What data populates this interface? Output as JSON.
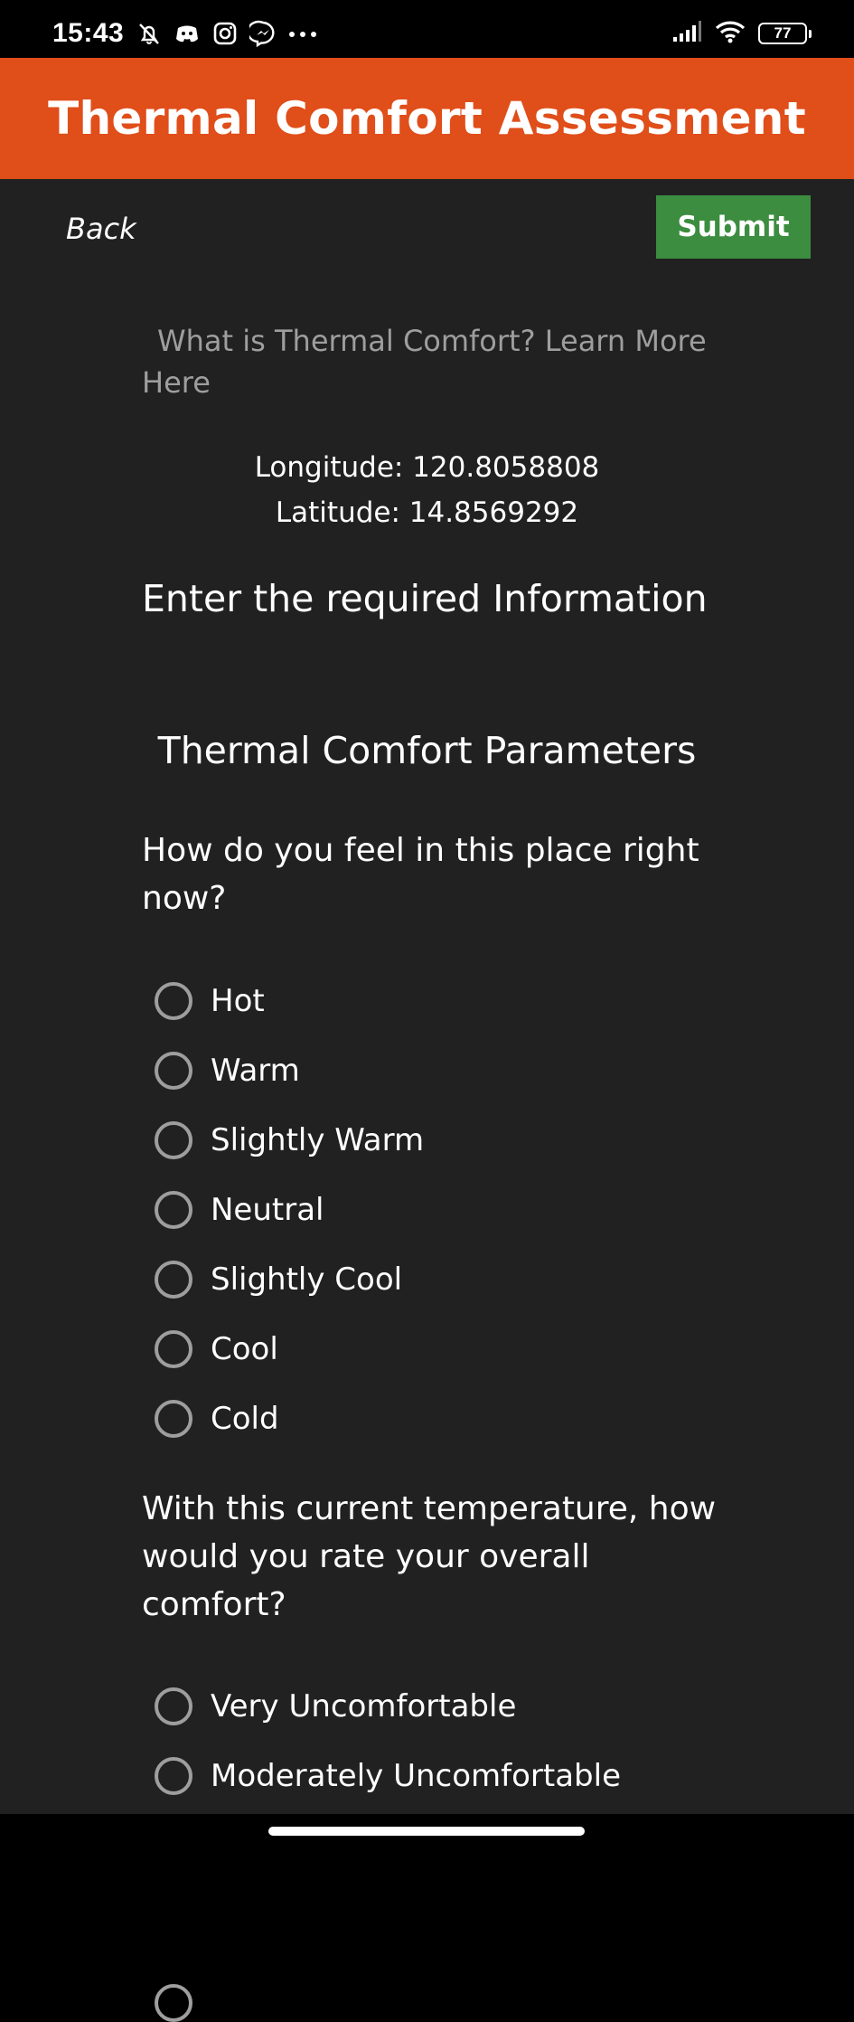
{
  "status_bar": {
    "time": "15:43",
    "left_icons": [
      "alarm-off-icon",
      "discord-icon",
      "instagram-icon",
      "messenger-icon",
      "more-dots-icon"
    ],
    "right_icons": [
      "signal-icon",
      "wifi-icon",
      "battery-icon"
    ],
    "battery_level": "77"
  },
  "header": {
    "title": "Thermal Comfort Assessment",
    "color": "#e04e1a"
  },
  "toolbar": {
    "back_label": "Back",
    "submit_label": "Submit",
    "submit_color": "#3c8d40"
  },
  "learn_more": "What is Thermal Comfort? Learn More Here",
  "location": {
    "longitude": "Longitude: 120.8058808",
    "latitude": "Latitude: 14.8569292"
  },
  "form": {
    "heading": "Enter the required Information",
    "params_heading": "Thermal Comfort Parameters",
    "questions": [
      {
        "text": "How do you feel in this place right now?",
        "options": [
          "Hot",
          "Warm",
          "Slightly Warm",
          "Neutral",
          "Slightly Cool",
          "Cool",
          "Cold"
        ]
      },
      {
        "text": "With this current temperature, how would you rate your overall comfort?",
        "options": [
          "Very Uncomfortable",
          "Moderately Uncomfortable"
        ]
      }
    ]
  },
  "colors": {
    "background": "#212121",
    "muted_text": "#9e9e9e"
  }
}
